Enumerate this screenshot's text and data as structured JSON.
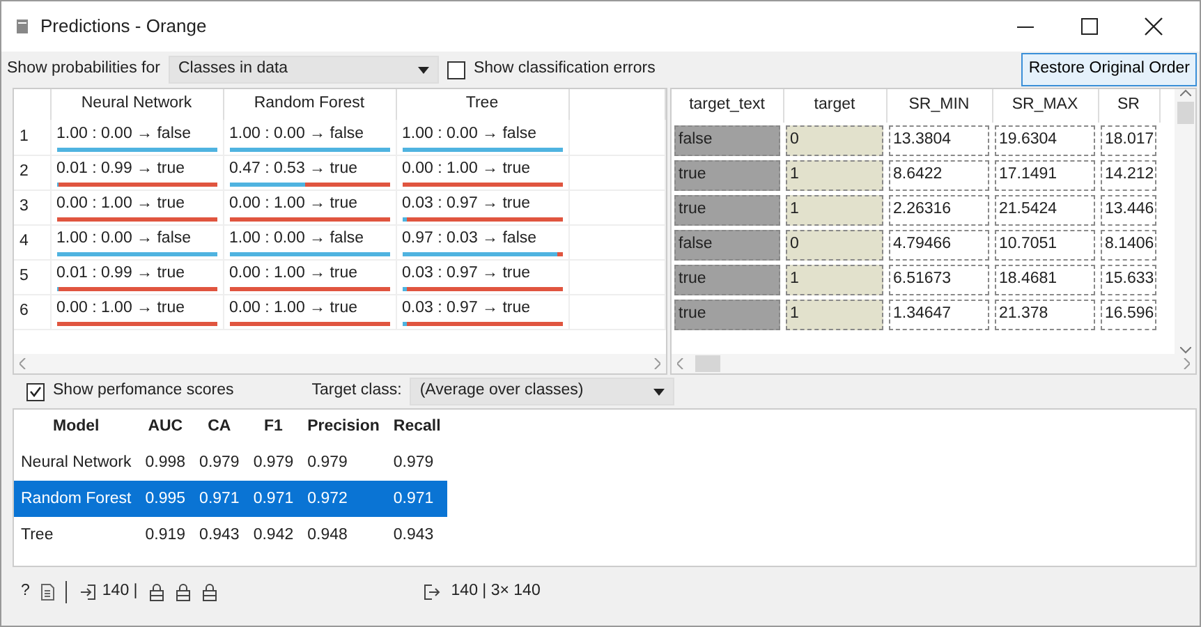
{
  "window": {
    "title": "Predictions - Orange"
  },
  "toolbar": {
    "probabilities_label": "Show probabilities for",
    "probabilities_value": "Classes in data",
    "errors_checkbox": {
      "label": "Show classification errors",
      "checked": false
    },
    "restore_button": "Restore Original Order"
  },
  "predictions": {
    "columns": [
      "Neural Network",
      "Random Forest",
      "Tree"
    ],
    "rows": [
      {
        "index": "1",
        "cells": [
          {
            "text": "1.00 : 0.00 → false",
            "level": 1
          },
          {
            "text": "1.00 : 0.00 → false",
            "level": 1
          },
          {
            "text": "1.00 : 0.00 → false",
            "level": 1
          }
        ]
      },
      {
        "index": "2",
        "cells": [
          {
            "text": "0.01 : 0.99 → true",
            "level": 0.01
          },
          {
            "text": "0.47 : 0.53 → true",
            "level": 0.47
          },
          {
            "text": "0.00 : 1.00 → true"
          }
        ]
      },
      {
        "index": "3",
        "cells": [
          {
            "text": "0.00 : 1.00 → true"
          },
          {
            "text": "0.00 : 1.00 → true"
          },
          {
            "text": "0.03 : 0.97 → true",
            "level": 0.03
          }
        ]
      },
      {
        "index": "4",
        "cells": [
          {
            "text": "1.00 : 0.00 → false",
            "level": 1
          },
          {
            "text": "1.00 : 0.00 → false",
            "level": 1
          },
          {
            "text": "0.97 : 0.03 → false",
            "level": 0.97
          }
        ]
      },
      {
        "index": "5",
        "cells": [
          {
            "text": "0.01 : 0.99 → true",
            "level": 0.01
          },
          {
            "text": "0.00 : 1.00 → true"
          },
          {
            "text": "0.03 : 0.97 → true",
            "level": 0.03
          }
        ]
      },
      {
        "index": "6",
        "cells": [
          {
            "text": "0.00 : 1.00 → true"
          },
          {
            "text": "0.00 : 1.00 → true"
          },
          {
            "text": "0.03 : 0.97 → true",
            "level": 0.03
          }
        ]
      }
    ]
  },
  "data_table": {
    "columns": [
      {
        "label": "target_text",
        "kind": "meta"
      },
      {
        "label": "target",
        "kind": "class"
      },
      {
        "label": "SR_MIN",
        "kind": "feature"
      },
      {
        "label": "SR_MAX",
        "kind": "feature"
      },
      {
        "label": "SR",
        "kind": "feature"
      }
    ],
    "rows": [
      [
        "false",
        "0",
        "13.3804",
        "19.6304",
        "18.017"
      ],
      [
        "true",
        "1",
        "8.6422",
        "17.1491",
        "14.212"
      ],
      [
        "true",
        "1",
        "2.26316",
        "21.5424",
        "13.446"
      ],
      [
        "false",
        "0",
        "4.79466",
        "10.7051",
        "8.1406"
      ],
      [
        "true",
        "1",
        "6.51673",
        "18.4681",
        "15.633"
      ],
      [
        "true",
        "1",
        "1.34647",
        "21.378",
        "16.596"
      ]
    ]
  },
  "performance": {
    "checkbox": {
      "label": "Show perfomance scores",
      "checked": true
    },
    "target_label": "Target class:",
    "target_value": "(Average over classes)",
    "columns": [
      "Model",
      "AUC",
      "CA",
      "F1",
      "Precision",
      "Recall"
    ],
    "rows": [
      {
        "cells": [
          "Neural Network",
          "0.998",
          "0.979",
          "0.979",
          "0.979",
          "0.979"
        ],
        "selected": false
      },
      {
        "cells": [
          "Random Forest",
          "0.995",
          "0.971",
          "0.971",
          "0.972",
          "0.971"
        ],
        "selected": true
      },
      {
        "cells": [
          "Tree",
          "0.919",
          "0.943",
          "0.942",
          "0.948",
          "0.943"
        ],
        "selected": false
      }
    ]
  },
  "status_bar": {
    "help": "?",
    "input_count": "140 |",
    "output_text": "140 | 3× 140"
  }
}
